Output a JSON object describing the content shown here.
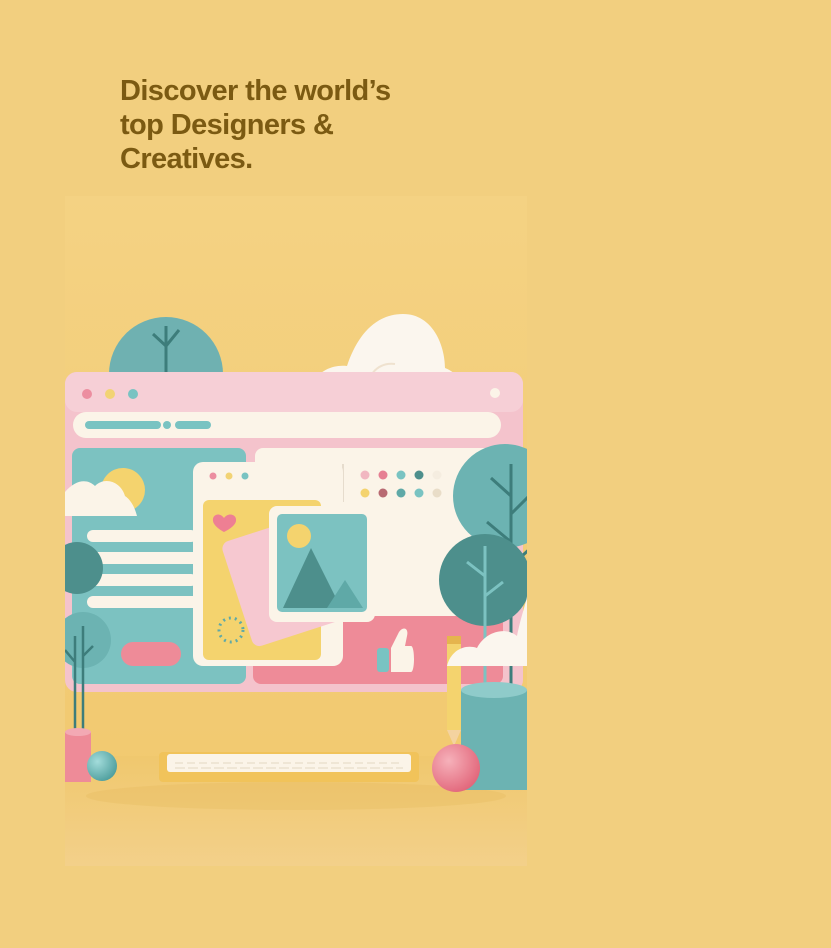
{
  "hero": {
    "headline_lines": [
      "Discover the world’s",
      "top Designers &",
      "Creatives."
    ]
  },
  "colors": {
    "background": "#f2cf7f",
    "headline": "#7b5a12",
    "pink": "#ee9aa5",
    "teal": "#79c3c2",
    "dark_teal": "#4d8f8c",
    "yellow": "#f4d36e",
    "cream": "#fbf4e8"
  },
  "illustration": {
    "subject": "3d-web-design-scene",
    "elements": [
      "browser-window",
      "photo-card",
      "heart-icon",
      "thumbs-up-icon",
      "keyboard",
      "pencil",
      "trees",
      "clouds",
      "spheres"
    ]
  }
}
